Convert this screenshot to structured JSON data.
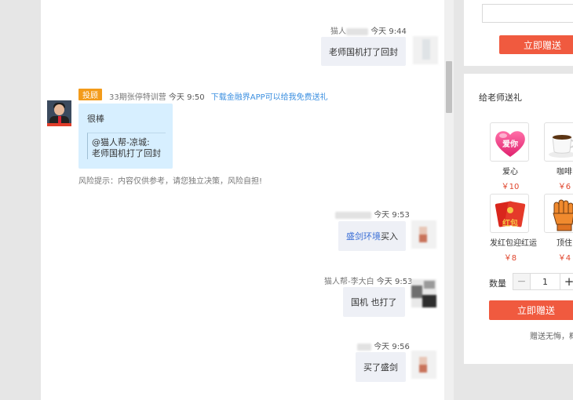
{
  "chat": {
    "messages": [
      {
        "sender": "猫人",
        "time": "今天 9:44",
        "text": "老师国机打了回封"
      },
      {
        "badge": "投顾",
        "sender": "33期张停特训营",
        "time": "今天 9:50",
        "promo": "下载金融界APP可以给我免费送礼",
        "text": "很棒",
        "quote_user": "@猫人帮-凉城:",
        "quote_text": "老师国机打了回封"
      },
      {
        "time": "今天 9:53",
        "text_link": "盛剑环境",
        "text_rest": "买入"
      },
      {
        "sender": "猫人帮-李大白",
        "time": "今天 9:53",
        "text": "国机 也打了"
      },
      {
        "time": "今天 9:56",
        "text": "买了盛剑"
      }
    ],
    "risk_notice": "风险提示：内容仅供参考，请您独立决策，风险自担!"
  },
  "sidebar": {
    "top_send_label": "立即赠送",
    "gift_title": "给老师送礼",
    "gifts": [
      {
        "name": "爱心",
        "price": "￥10",
        "icon": "heart-icon",
        "icon_text": "爱你"
      },
      {
        "name": "咖啡",
        "price": "￥6",
        "icon": "coffee-icon"
      },
      {
        "name": "发红包迎红运",
        "price": "￥8",
        "icon": "red-envelope-icon",
        "icon_text": "红包"
      },
      {
        "name": "顶住",
        "price": "￥4",
        "icon": "fist-icon"
      }
    ],
    "quantity_label": "数量",
    "quantity_value": "1",
    "minus": "−",
    "plus": "+",
    "send_label": "立即赠送",
    "note": "赠送无悔，概"
  },
  "colors": {
    "accent": "#f05a3f",
    "badge": "#f39b1a",
    "quote_bg": "#d7efff",
    "link": "#3b6fd6",
    "price": "#e0452c"
  }
}
